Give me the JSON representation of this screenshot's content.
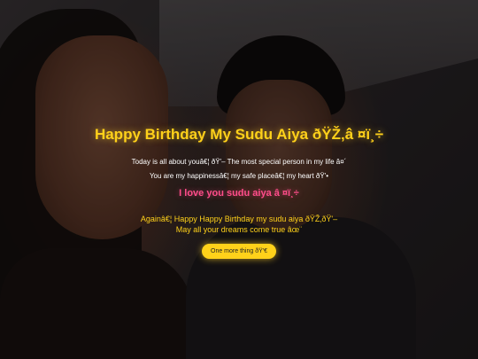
{
  "title": "Happy Birthday My Sudu Aiya ðŸŽ‚â    ¤ï¸÷",
  "messages": {
    "line1": "Today is all about youâ€¦ ðŸ'– The most special person in my life â¤´",
    "line2": "You are my happinessâ€¦ my safe placeâ€¦ my heart ðŸ'•",
    "love": "I love you sudu aiya â    ¤ï¸÷",
    "again": "Againâ€¦ Happy Happy Birthday my sudu aiya ðŸŽ‚ðŸ'– May all your dreams come true âœ¨"
  },
  "button": {
    "label": "One more thing ðŸ'€"
  },
  "colors": {
    "title": "#ffd11a",
    "love": "#ff4d8a",
    "button": "#ffd11a"
  }
}
